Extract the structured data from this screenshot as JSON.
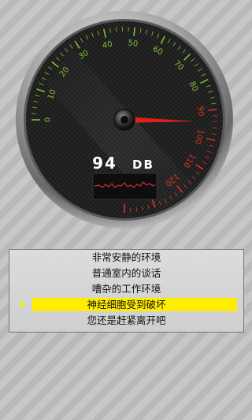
{
  "gauge": {
    "tick_labels": [
      "0",
      "10",
      "20",
      "30",
      "40",
      "50",
      "60",
      "70",
      "80",
      "90",
      "100",
      "110",
      "120",
      "130",
      "140"
    ],
    "red_from": 90,
    "needle_value": 94,
    "colors": {
      "green": "#7fbf3a",
      "red": "#d8361e",
      "needle": "#e0201a"
    }
  },
  "readout": {
    "value": "94",
    "unit": "DB"
  },
  "levels": {
    "items": [
      "非常安静的环境",
      "普通室内的谈话",
      "嘈杂的工作环境",
      "神经细胞受到破坏",
      "您还是赶紧离开吧"
    ],
    "selected_index": 3,
    "highlight_color": "#ffee00"
  }
}
